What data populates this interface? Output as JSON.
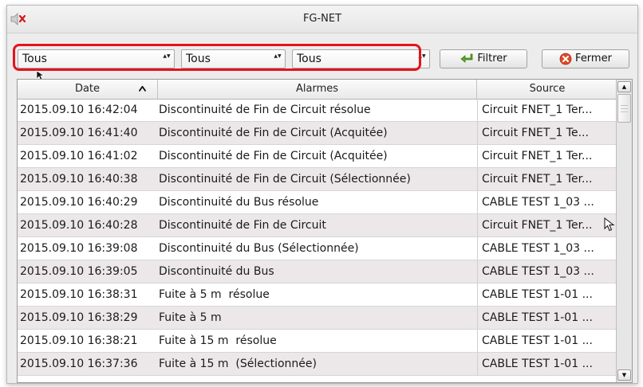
{
  "window": {
    "title": "FG-NET"
  },
  "filters": {
    "combo1": "Tous",
    "combo2": "Tous",
    "combo3": "Tous",
    "filter_button": "Filtrer",
    "close_button": "Fermer"
  },
  "table": {
    "columns": [
      "Date",
      "Alarmes",
      "Source"
    ],
    "sorted_column": "Date",
    "sort_direction": "ascending",
    "rows": [
      {
        "date": "2015.09.10 16:42:04",
        "alarm": "Discontinuité de Fin de Circuit résolue",
        "source": "Circuit FNET_1 Ter..."
      },
      {
        "date": "2015.09.10 16:41:40",
        "alarm": "Discontinuité de Fin de Circuit (Acquitée)",
        "source": "Circuit FNET_1 Te..."
      },
      {
        "date": "2015.09.10 16:41:02",
        "alarm": "Discontinuité de Fin de Circuit (Acquitée)",
        "source": "Circuit FNET_1 Ter..."
      },
      {
        "date": "2015.09.10 16:40:38",
        "alarm": "Discontinuité de Fin de Circuit (Sélectionnée)",
        "source": "Circuit FNET_1 Ter..."
      },
      {
        "date": "2015.09.10 16:40:29",
        "alarm": "Discontinuité du Bus résolue",
        "source": "CABLE TEST 1_03 ..."
      },
      {
        "date": "2015.09.10 16:40:28",
        "alarm": "Discontinuité de Fin de Circuit",
        "source": "Circuit FNET_1 Ter..."
      },
      {
        "date": "2015.09.10 16:39:08",
        "alarm": "Discontinuité du Bus (Sélectionnée)",
        "source": "CABLE TEST 1_03 ..."
      },
      {
        "date": "2015.09.10 16:39:05",
        "alarm": "Discontinuité du Bus",
        "source": "CABLE TEST 1_03 ..."
      },
      {
        "date": "2015.09.10 16:38:31",
        "alarm": "Fuite à 5 m  résolue",
        "source": "CABLE TEST 1-01 ..."
      },
      {
        "date": "2015.09.10 16:38:29",
        "alarm": "Fuite à 5 m",
        "source": "CABLE TEST 1-01 ..."
      },
      {
        "date": "2015.09.10 16:38:21",
        "alarm": "Fuite à 15 m  résolue",
        "source": "CABLE TEST 1-01 ..."
      },
      {
        "date": "2015.09.10 16:37:36",
        "alarm": "Fuite à 15 m  (Sélectionnée)",
        "source": "CABLE TEST 1-01 ..."
      }
    ]
  },
  "colors": {
    "highlight": "#e3141b",
    "alt_row": "#ece8ea",
    "filter_icon": "#5aa52a",
    "close_icon": "#e04a2a"
  },
  "icons": [
    "mute-icon",
    "filter-arrow-icon",
    "close-circle-icon",
    "sort-up-icon",
    "scroll-up-icon",
    "scroll-down-icon",
    "mouse-pointer-icon"
  ]
}
